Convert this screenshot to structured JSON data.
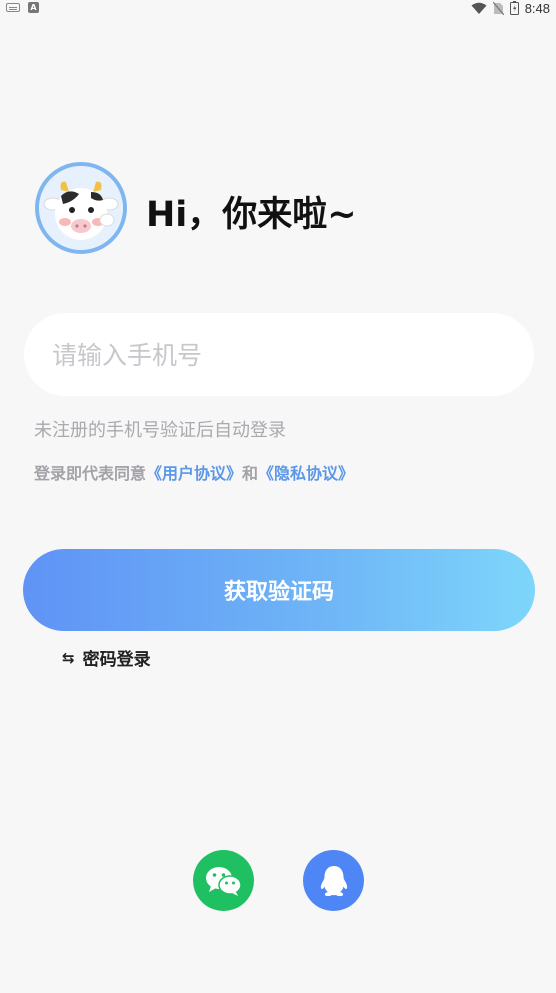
{
  "status_bar": {
    "time": "8:48"
  },
  "greeting": "Hi，你来啦~",
  "phone": {
    "placeholder": "请输入手机号",
    "value": ""
  },
  "hint": "未注册的手机号验证后自动登录",
  "agreement": {
    "prefix": "登录即代表同意",
    "user_agreement": "《用户协议》",
    "conjunction": "和",
    "privacy_policy": "《隐私协议》"
  },
  "get_code_label": "获取验证码",
  "password_login": {
    "icon": "swap-arrows-icon",
    "symbol": "⇆",
    "label": "密码登录"
  },
  "social": [
    {
      "name": "wechat",
      "icon": "wechat-icon",
      "color": "#1fc062"
    },
    {
      "name": "qq",
      "icon": "qq-icon",
      "color": "#4f86f5"
    }
  ],
  "colors": {
    "accent_start": "#5f93f5",
    "accent_end": "#7ed6fb",
    "link": "#5d97e8"
  }
}
